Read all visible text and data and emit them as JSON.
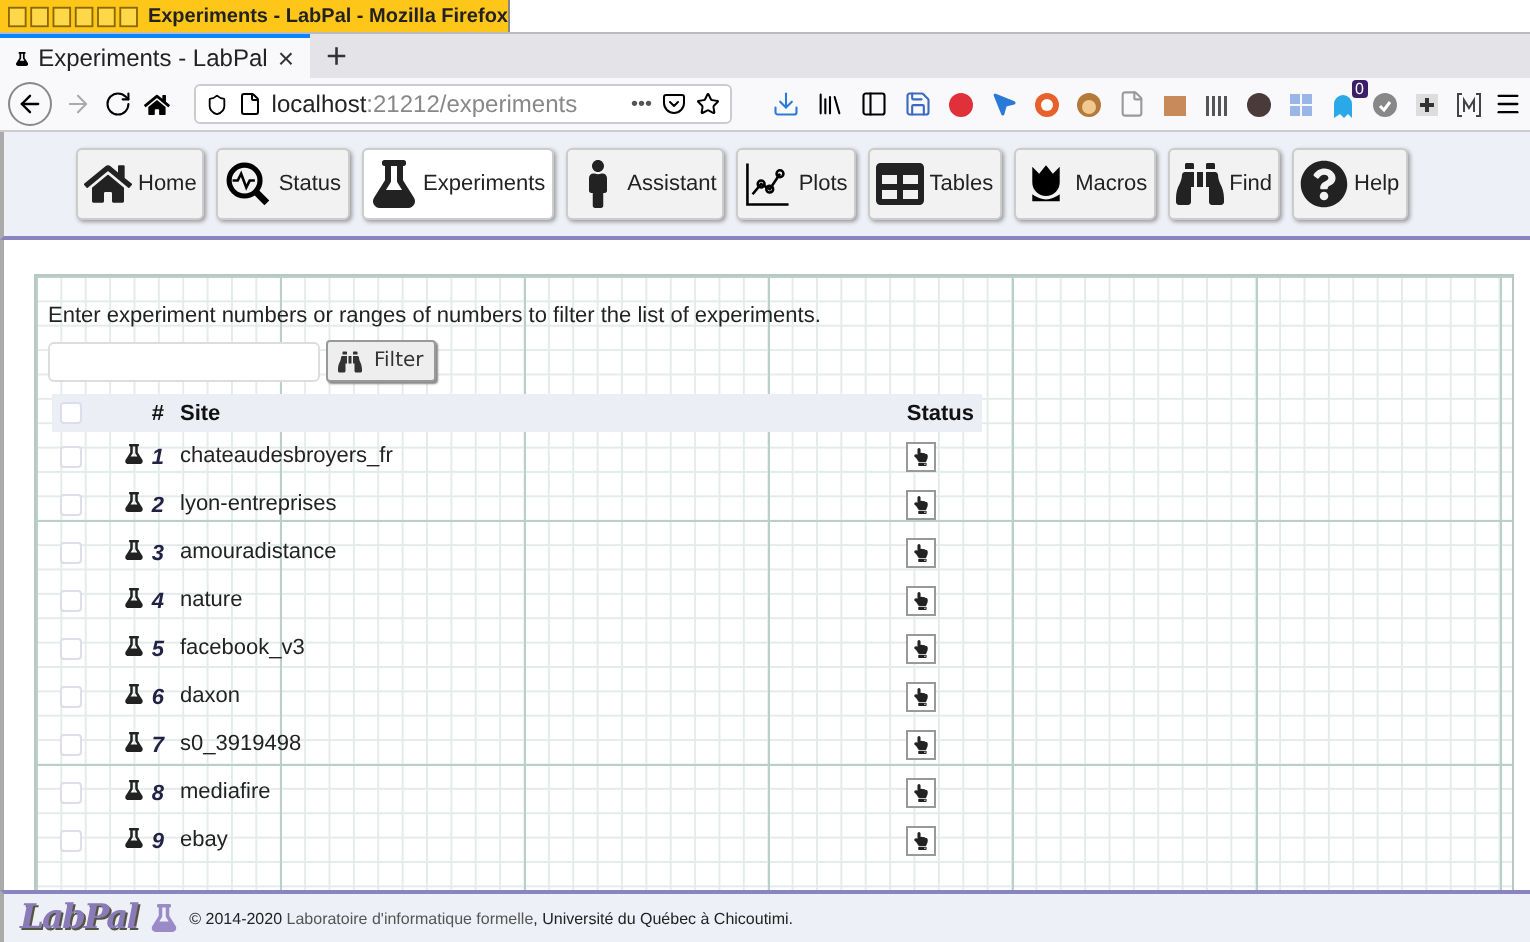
{
  "window": {
    "title": "Experiments - LabPal - Mozilla Firefox"
  },
  "browser": {
    "tab_title": "Experiments - LabPal",
    "tab_close": "×",
    "new_tab": "+",
    "url_host": "localhost",
    "url_rest": ":21212/experiments",
    "page_actions": "•••",
    "badge": "0"
  },
  "nav": [
    {
      "label": "Home",
      "selected": false
    },
    {
      "label": "Status",
      "selected": false
    },
    {
      "label": "Experiments",
      "selected": true
    },
    {
      "label": "Assistant",
      "selected": false
    },
    {
      "label": "Plots",
      "selected": false
    },
    {
      "label": "Tables",
      "selected": false
    },
    {
      "label": "Macros",
      "selected": false
    },
    {
      "label": "Find",
      "selected": false
    },
    {
      "label": "Help",
      "selected": false
    }
  ],
  "intro": "Enter experiment numbers or ranges of numbers to filter the list of experiments.",
  "filter": {
    "button": "Filter"
  },
  "table": {
    "columns": [
      "#",
      "Site",
      "Status"
    ],
    "all_checked": false,
    "rows": [
      {
        "number": "1",
        "site": "chateaudesbroyers_fr",
        "checked": false
      },
      {
        "number": "2",
        "site": "lyon-entreprises",
        "checked": false
      },
      {
        "number": "3",
        "site": "amouradistance",
        "checked": false
      },
      {
        "number": "4",
        "site": "nature",
        "checked": false
      },
      {
        "number": "5",
        "site": "facebook_v3",
        "checked": false
      },
      {
        "number": "6",
        "site": "daxon",
        "checked": false
      },
      {
        "number": "7",
        "site": "s0_3919498",
        "checked": false
      },
      {
        "number": "8",
        "site": "mediafire",
        "checked": false
      },
      {
        "number": "9",
        "site": "ebay",
        "checked": false
      }
    ]
  },
  "footer": {
    "logo": "LabPal",
    "years": "© 2014-2020 ",
    "lab": "Laboratoire d'informatique formelle",
    "rest": ", Université du Québec à Chicoutimi."
  }
}
